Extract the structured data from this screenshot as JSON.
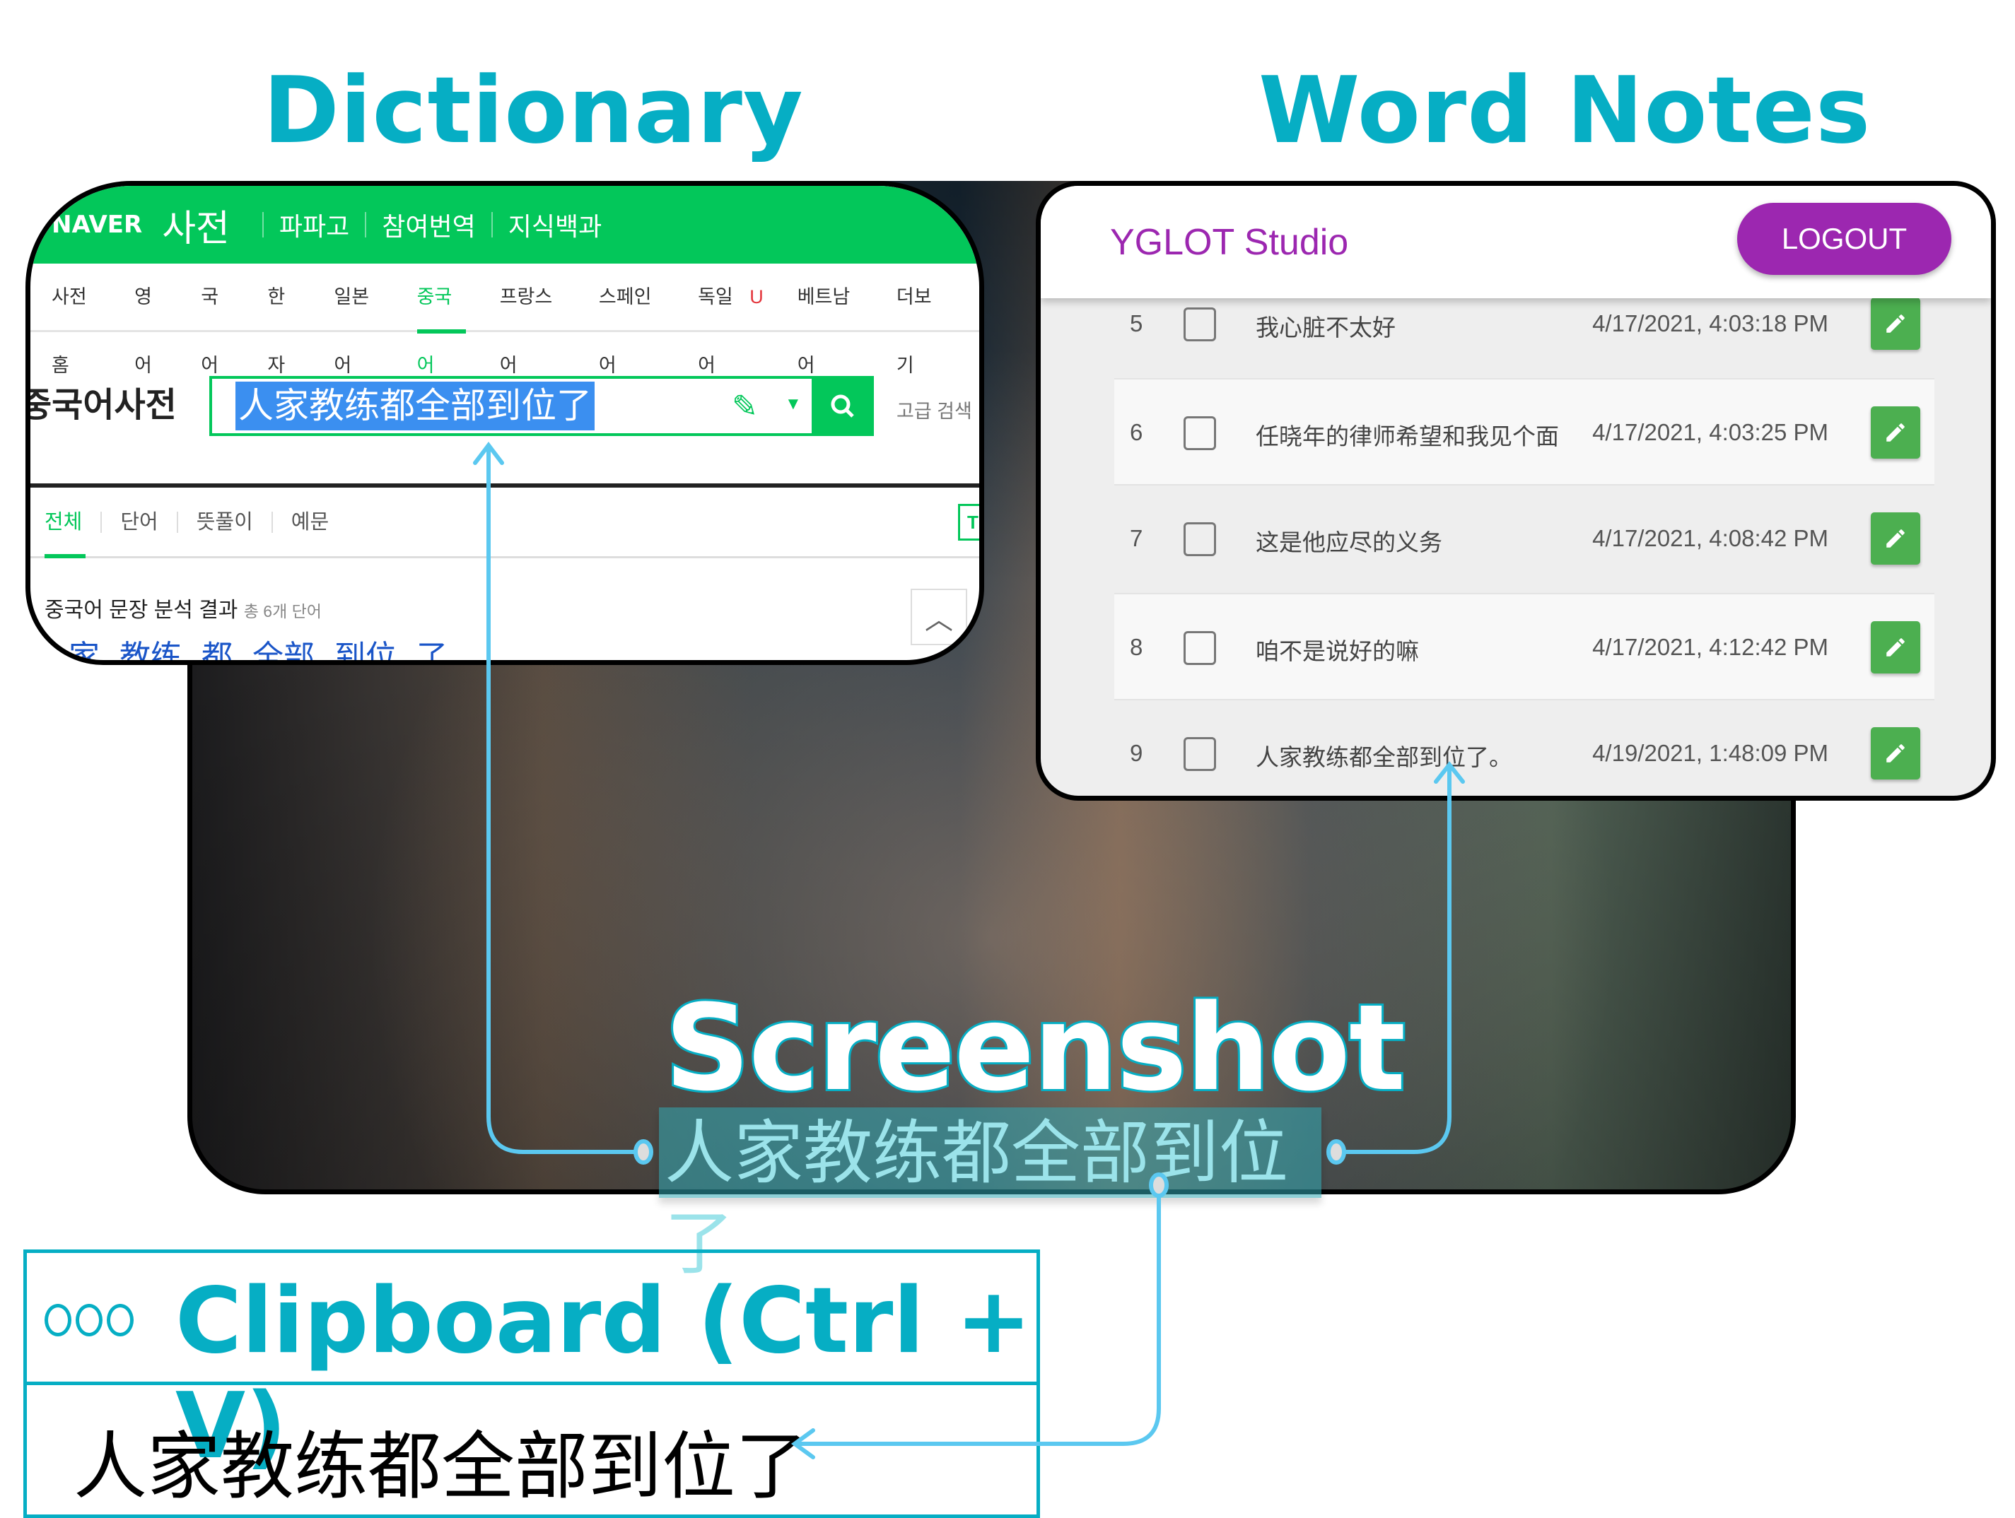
{
  "labels": {
    "dictionary": "Dictionary",
    "word_notes": "Word Notes",
    "screenshot": "Screenshot",
    "subtitle": "人家教练都全部到位了"
  },
  "dictionary": {
    "logo": "NAVER",
    "service": "사전",
    "header_links": [
      "파파고",
      "참여번역",
      "지식백과"
    ],
    "nav": [
      "사전홈",
      "영어",
      "국어",
      "한자",
      "일본어",
      "중국어",
      "프랑스어",
      "스페인어",
      "독일어",
      "베트남어",
      "더보기"
    ],
    "nav_active": "중국어",
    "nav_badge": "U",
    "search_label": "중국어사전",
    "search_value": "人家教练都全部到位了",
    "advanced": "고급 검색",
    "tabs": [
      "전체",
      "단어",
      "뜻풀이",
      "예문"
    ],
    "tab_toggle": "T",
    "result_title": "중국어 문장 분석 결과",
    "result_count": "총 6개 단어",
    "words": [
      "人家",
      "教练",
      "都",
      "全部",
      "到位",
      "了"
    ]
  },
  "notes": {
    "brand": "YGLOT Studio",
    "logout": "LOGOUT",
    "rows": [
      {
        "num": "5",
        "text": "我心脏不太好",
        "date": "4/17/2021, 4:03:18 PM"
      },
      {
        "num": "6",
        "text": "任晓年的律师希望和我见个面",
        "date": "4/17/2021, 4:03:25 PM"
      },
      {
        "num": "7",
        "text": "这是他应尽的义务",
        "date": "4/17/2021, 4:08:42 PM"
      },
      {
        "num": "8",
        "text": "咱不是说好的嘛",
        "date": "4/17/2021, 4:12:42 PM"
      },
      {
        "num": "9",
        "text": "人家教练都全部到位了。",
        "date": "4/19/2021, 1:48:09 PM"
      }
    ]
  },
  "clipboard": {
    "title": "Clipboard (Ctrl + V)",
    "text": "人家教练都全部到位了"
  },
  "colors": {
    "accent": "#06aec4",
    "naver_green": "#03c75a",
    "brand_purple": "#9c27b0",
    "edit_green": "#4caf50",
    "connector": "#5bc8f0"
  }
}
